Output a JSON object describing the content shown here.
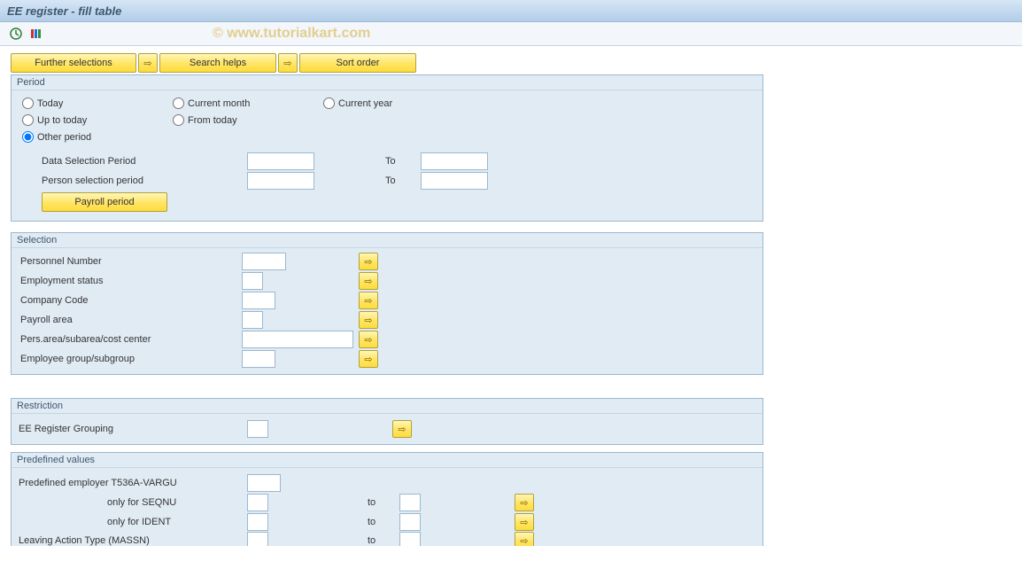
{
  "title": "EE register - fill table",
  "watermark": "© www.tutorialkart.com",
  "buttons": {
    "further_selections": "Further selections",
    "search_helps": "Search helps",
    "sort_order": "Sort order",
    "payroll_period": "Payroll period"
  },
  "period": {
    "title": "Period",
    "radios": {
      "today": "Today",
      "current_month": "Current month",
      "current_year": "Current year",
      "up_to_today": "Up to today",
      "from_today": "From today",
      "other_period": "Other period"
    },
    "data_selection_period": "Data Selection Period",
    "person_selection_period": "Person selection period",
    "to": "To"
  },
  "selection": {
    "title": "Selection",
    "personnel_number": "Personnel Number",
    "employment_status": "Employment status",
    "company_code": "Company Code",
    "payroll_area": "Payroll area",
    "pers_area": "Pers.area/subarea/cost center",
    "employee_group": "Employee group/subgroup"
  },
  "restriction": {
    "title": "Restriction",
    "ee_register_grouping": "EE Register Grouping"
  },
  "predefined": {
    "title": "Predefined values",
    "employer": "Predefined employer T536A-VARGU",
    "seqnu": "only for SEQNU",
    "ident": "only for IDENT",
    "leaving": "Leaving Action Type (MASSN)",
    "to": "to"
  }
}
